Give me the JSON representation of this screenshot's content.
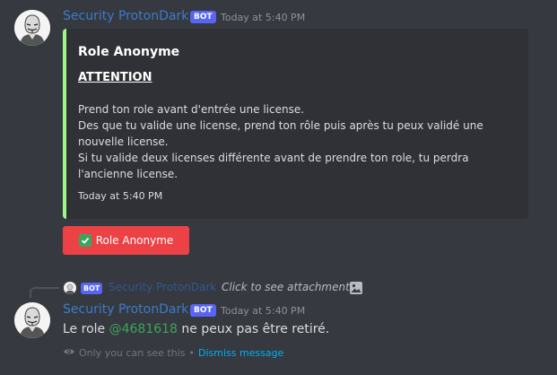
{
  "message1": {
    "author": "Security ProtonDark",
    "bot_tag": "BOT",
    "timestamp": "Today at 5:40 PM",
    "embed": {
      "title": "Role Anonyme",
      "heading": "ATTENTION",
      "description": "Prend ton role avant d'entrée une license.\nDes que tu valide une license, prend ton rôle puis après tu peux validé une nouvelle license.\nSi tu valide deux licenses différente avant de prendre ton role, tu perdra l'ancienne license.",
      "footer": "Today at 5:40 PM",
      "accent_color": "#9df785"
    },
    "button": {
      "label": "Role Anonyme",
      "icon": "check-mark-icon",
      "color": "#ed4245"
    }
  },
  "reply": {
    "bot_tag": "BOT",
    "author": "Security ProtonDark",
    "attachment_text": "Click to see attachment",
    "icon": "image-icon"
  },
  "message2": {
    "author": "Security ProtonDark",
    "bot_tag": "BOT",
    "timestamp": "Today at 5:40 PM",
    "content_prefix": "Le role ",
    "mention": "@4681618",
    "content_suffix": " ne peux pas être retiré.",
    "ephemeral_notice": "Only you can see this",
    "separator": "•",
    "dismiss_label": "Dismiss message"
  }
}
